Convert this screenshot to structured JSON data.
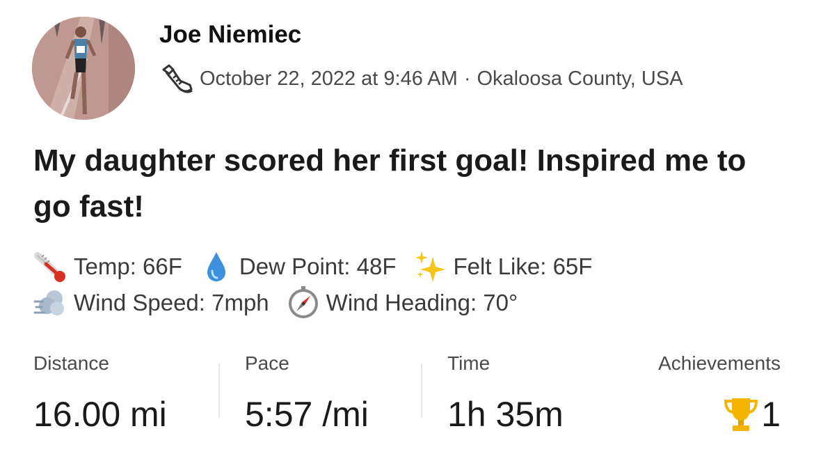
{
  "athlete": {
    "name": "Joe Niemiec",
    "avatar_icon": "runner-photo-avatar"
  },
  "meta": {
    "activity_icon": "running-shoe-icon",
    "datetime": "October 22, 2022 at 9:46 AM",
    "separator": "·",
    "location": "Okaloosa County, USA"
  },
  "activity": {
    "title": "My daughter scored her first goal! Inspired me to go fast!"
  },
  "weather": {
    "temp": {
      "icon": "thermometer-icon",
      "text": "Temp: 66F"
    },
    "dew_point": {
      "icon": "droplet-icon",
      "text": "Dew Point: 48F"
    },
    "felt_like": {
      "icon": "sparkles-icon",
      "text": "Felt Like: 65F"
    },
    "wind_speed": {
      "icon": "wind-icon",
      "text": "Wind Speed: 7mph"
    },
    "wind_heading": {
      "icon": "compass-icon",
      "text": "Wind Heading: 70°"
    }
  },
  "stats": {
    "distance": {
      "label": "Distance",
      "value": "16.00 mi"
    },
    "pace": {
      "label": "Pace",
      "value": "5:57 /mi"
    },
    "time": {
      "label": "Time",
      "value": "1h 35m"
    },
    "achievements": {
      "label": "Achievements",
      "value": "1",
      "icon": "trophy-icon"
    }
  },
  "colors": {
    "text_primary": "#1a1a1a",
    "text_secondary": "#4a4a4a",
    "trophy_gold": "#f4b400",
    "droplet_blue": "#3d8fe0"
  }
}
